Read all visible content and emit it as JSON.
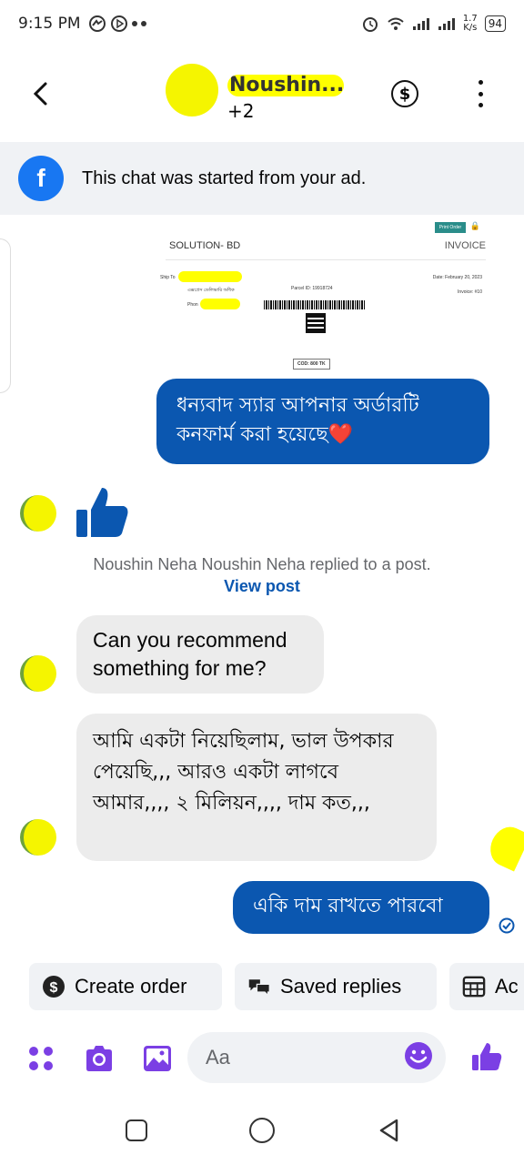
{
  "status_bar": {
    "time": "9:15 PM",
    "net_speed_value": "1.7",
    "net_speed_unit": "K/s",
    "battery": "94"
  },
  "header": {
    "contact_name": "Noushin...",
    "participants_more": "+2",
    "icons": {
      "back": "chevron-left-icon",
      "payment": "dollar-icon",
      "more": "more-vertical-icon"
    }
  },
  "ad_banner": {
    "text": "This chat was started from your ad."
  },
  "invoice_image": {
    "button_label": "Print Order",
    "company": "SOLUTION- BD",
    "title": "INVOICE",
    "ship_to_label": "Ship To",
    "address_text": "এক্সপ্রেস ডেলিভারি অধিক",
    "phone_label": "Phon",
    "parcel_id": "Parcel ID: 19918724",
    "date": "Date: February 20, 2023",
    "invoice_no": "Invoice: #10",
    "cod": "COD: 800 TK"
  },
  "messages": [
    {
      "id": "m1",
      "direction": "out",
      "text": "ধন্যবাদ স্যার  আপনার অর্ডারটি কনফার্ম করা হয়েছে❤️"
    },
    {
      "id": "m2",
      "direction": "in",
      "text": "Can you recommend something for me?"
    },
    {
      "id": "m3",
      "direction": "in",
      "text": "আমি একটা নিয়েছিলাম, ভাল উপকার পেয়েছি,,, আরও একটা লাগবে আমার,,,, ২ মিলিয়ন,,,, দাম কত,,,"
    },
    {
      "id": "m4",
      "direction": "out",
      "text": "একি দাম রাখতে পারবো"
    }
  ],
  "reply_note": {
    "text": "Noushin Neha Noushin Neha replied to a post.",
    "link": "View post"
  },
  "quick_actions": [
    {
      "label": "Create order",
      "icon": "dollar-circle-icon"
    },
    {
      "label": "Saved replies",
      "icon": "saved-replies-icon"
    },
    {
      "label": "Ac",
      "icon": "calendar-grid-icon"
    }
  ],
  "composer": {
    "placeholder": "Aa",
    "icons": [
      "apps-grid-icon",
      "camera-icon",
      "gallery-icon",
      "emoji-icon",
      "thumbs-up-icon"
    ]
  },
  "colors": {
    "brand_blue": "#0b57b0",
    "messenger_purple": "#7b3fe4",
    "facebook_blue": "#1877f2",
    "incoming_bubble": "#ececec"
  }
}
